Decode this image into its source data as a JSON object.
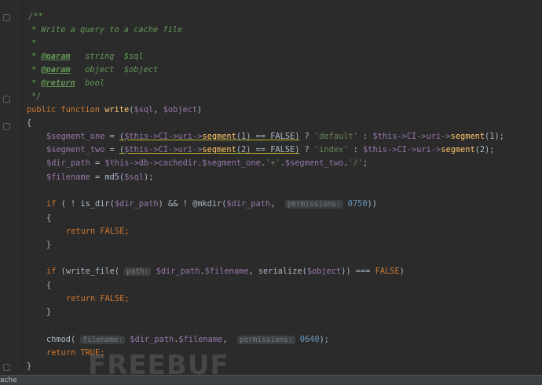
{
  "code": {
    "doc_open": "/**",
    "doc_summary": "* Write a query to a cache file",
    "doc_blank": "*",
    "doc_star": "*",
    "param_tag": "@param",
    "param1_type": "string",
    "param1_var": "$sql",
    "param2_type": "object",
    "param2_var": "$object",
    "return_tag": "@return",
    "return_type": "bool",
    "doc_close": "*/",
    "kw_public": "public",
    "kw_function": "function",
    "func_name": "write",
    "var_sql": "$sql",
    "var_object": "$object",
    "brace_open": "{",
    "brace_close": "}",
    "seg_one": "$segment_one",
    "seg_two": "$segment_two",
    "this_ci_uri": "$this->CI->uri->",
    "segment_fn": "segment",
    "seg1_cond_tail": "(1) == FALSE)",
    "seg2_cond_tail": "(2) == FALSE)",
    "str_default": "'default'",
    "str_index": "'index'",
    "seg1_call_tail": "(1);",
    "seg2_call_tail": "(2);",
    "dir_path": "$dir_path",
    "this_db": "$this->db->cachedir.",
    "str_plus": "'+'",
    "str_slash": "'/'",
    "filename": "$filename",
    "md5_fn": "md5",
    "kw_if": "if",
    "is_dir_fn": "is_dir",
    "mkdir_fn": "@mkdir",
    "hint_permissions": "permissions:",
    "num_0750": "0750",
    "kw_return": "return",
    "kw_false": "FALSE",
    "kw_true": "TRUE",
    "write_file_fn": "write_file",
    "hint_path": "path:",
    "serialize_fn": "serialize",
    "chmod_fn": "chmod",
    "hint_filename": "filename:",
    "num_0640": "0640"
  },
  "watermark": "FREEBUF",
  "status_bar": {
    "label": "ache"
  }
}
